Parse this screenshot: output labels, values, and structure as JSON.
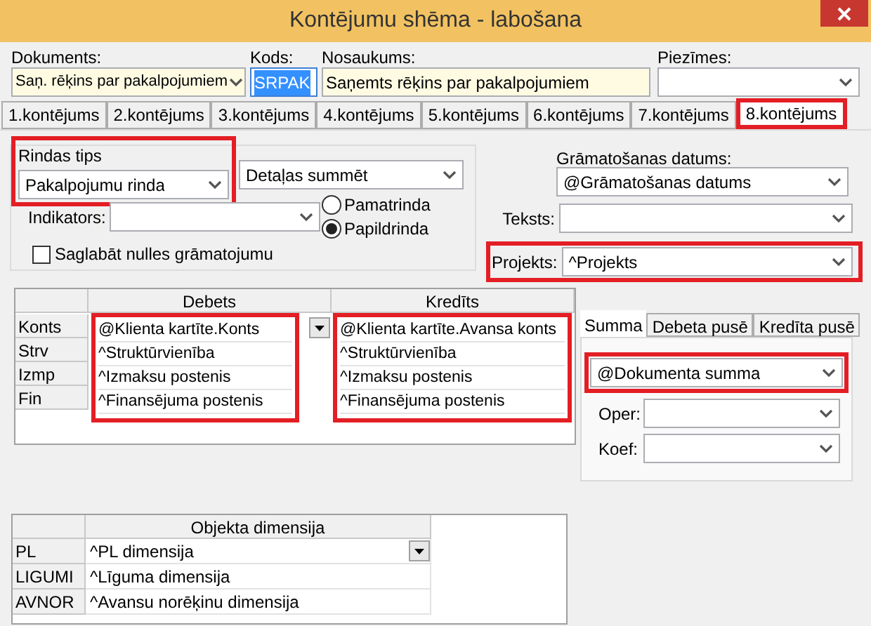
{
  "window": {
    "title": "Kontējumu shēma - labošana"
  },
  "header": [
    {
      "kind": "combo",
      "label": "Dokuments:",
      "value": "Saņ. rēķins par pakalpojumiem"
    },
    {
      "kind": "text",
      "label": "Kods:",
      "value": "SRPAK",
      "text_selected": true
    },
    {
      "kind": "text",
      "label": "Nosaukums:",
      "value": "Saņemts rēķins par pakalpojumiem"
    },
    {
      "kind": "combo",
      "label": "Piezīmes:"
    }
  ],
  "tabs": [
    {
      "label": "1.kontējums",
      "selected": false,
      "highlighted": false
    },
    {
      "label": "2.kontējums",
      "selected": false,
      "highlighted": false
    },
    {
      "label": "3.kontējums",
      "selected": false,
      "highlighted": false
    },
    {
      "label": "4.kontējums",
      "selected": false,
      "highlighted": false
    },
    {
      "label": "5.kontējums",
      "selected": false,
      "highlighted": false
    },
    {
      "label": "6.kontējums",
      "selected": false,
      "highlighted": false
    },
    {
      "label": "7.kontējums",
      "selected": false,
      "highlighted": false
    },
    {
      "label": "8.kontējums",
      "selected": true,
      "highlighted": true
    }
  ],
  "row_type": {
    "label": "Rindas tips",
    "value": "Pakalpojumu rinda",
    "highlighted": true
  },
  "summing": {
    "value": "Detaļas summēt"
  },
  "indicator": {
    "label": "Indikators:"
  },
  "radios": [
    {
      "label": "Pamatrinda",
      "selected": false
    },
    {
      "label": "Papildrinda",
      "selected": true
    }
  ],
  "checkbox": {
    "label": "Saglabāt nulles grāmatojumu",
    "checked": false
  },
  "right_fields": [
    {
      "kind": "stacked",
      "label": "Grāmatošanas datums:",
      "value": "@Grāmatošanas datums"
    },
    {
      "kind": "inline",
      "label": "Teksts:"
    },
    {
      "kind": "inline",
      "label": "Projekts:",
      "value": "^Projekts",
      "highlighted": true
    }
  ],
  "accounts_grid": {
    "columns": [
      {
        "label": "Debets",
        "highlighted": true
      },
      {
        "label": "Kredīts",
        "highlighted": true
      }
    ],
    "rows": [
      {
        "label": "Konts",
        "debit": "@Klienta kartīte.Konts",
        "credit": "@Klienta kartīte.Avansa konts"
      },
      {
        "label": "Strv",
        "debit": "^Struktūrvienība",
        "credit": "^Struktūrvienība"
      },
      {
        "label": "Izmp",
        "debit": "^Izmaksu postenis",
        "credit": "^Izmaksu postenis"
      },
      {
        "label": "Fin",
        "debit": "^Finansējuma postenis",
        "credit": "^Finansējuma postenis"
      }
    ]
  },
  "amount_panel": {
    "tabs": [
      {
        "label": "Summa",
        "selected": true
      },
      {
        "label": "Debeta pusē",
        "selected": false
      },
      {
        "label": "Kredīta pusē",
        "selected": false
      }
    ],
    "value": "@Dokumenta summa",
    "highlighted": true,
    "fields": [
      {
        "label": "Oper:"
      },
      {
        "label": "Koef:"
      }
    ]
  },
  "dimension_grid": {
    "column": "Objekta dimensija",
    "rows": [
      {
        "label": "PL",
        "value": "^PL dimensija"
      },
      {
        "label": "LIGUMI",
        "value": "^Līguma dimensija"
      },
      {
        "label": "AVNOR",
        "value": "^Avansu norēķinu dimensija"
      }
    ]
  }
}
